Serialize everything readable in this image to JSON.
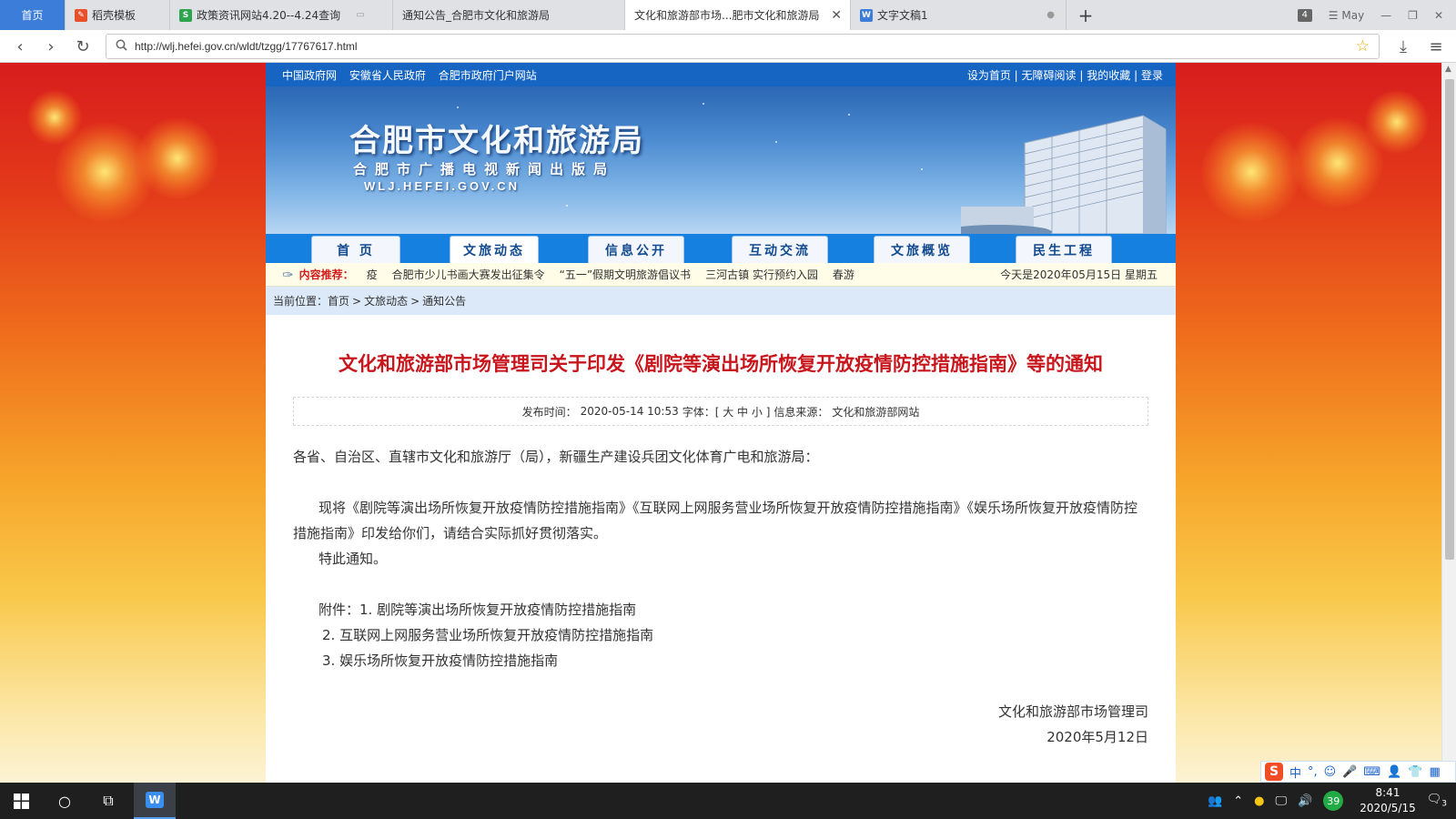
{
  "browser": {
    "tabs": [
      {
        "label": "首页",
        "icon": "home"
      },
      {
        "label": "稻壳模板",
        "icon": "docer-icon"
      },
      {
        "label": "政策资讯网站4.20--4.24查询",
        "icon": "sheet-icon"
      },
      {
        "label": "通知公告_合肥市文化和旅游局",
        "icon": ""
      },
      {
        "label": "文化和旅游部市场...肥市文化和旅游局",
        "icon": ""
      },
      {
        "label": "文字文稿1",
        "icon": "word-icon"
      }
    ],
    "tab_count": "4",
    "profile_label": "May",
    "url": "http://wlj.hefei.gov.cn/wldt/tzgg/17767617.html"
  },
  "site": {
    "top_links": [
      "中国政府网",
      "安徽省人民政府",
      "合肥市政府门户网站"
    ],
    "top_right": [
      "设为首页",
      "|",
      "无障碍阅读",
      "|",
      "我的收藏",
      "|",
      "登录"
    ],
    "title": "合肥市文化和旅游局",
    "subtitle": "合肥市广播电视新闻出版局",
    "domain": "WLJ.HEFEI.GOV.CN",
    "menu": [
      "首 页",
      "文旅动态",
      "信息公开",
      "互动交流",
      "文旅概览",
      "民生工程"
    ],
    "menu_active": "文旅动态",
    "ticker": {
      "label": "内容推荐：",
      "items": [
        "疫 ",
        "合肥市少儿书画大赛发出征集令",
        "“五一”假期文明旅游倡议书",
        "三河古镇 实行预约入园",
        "春游"
      ],
      "date": "今天是2020年05月15日 星期五"
    },
    "breadcrumb": {
      "prefix": "当前位置：",
      "items": [
        "首页",
        "文旅动态",
        "通知公告"
      ],
      "sep": ">"
    }
  },
  "article": {
    "title": "文化和旅游部市场管理司关于印发《剧院等演出场所恢复开放疫情防控措施指南》等的通知",
    "meta": {
      "publish_label": "发布时间：",
      "publish_time": "2020-05-14 10:53",
      "font_label": "字体：[ 大 中 小 ]",
      "source_label": "信息来源：",
      "source": "文化和旅游部网站"
    },
    "salutation": "各省、自治区、直辖市文化和旅游厅（局），新疆生产建设兵团文化体育广电和旅游局：",
    "body": "现将《剧院等演出场所恢复开放疫情防控措施指南》《互联网上网服务营业场所恢复开放疫情防控措施指南》《娱乐场所恢复开放疫情防控措施指南》印发给你们，请结合实际抓好贯彻落实。",
    "closing": "特此通知。",
    "attachments_label": "附件：1. 剧院等演出场所恢复开放疫情防控措施指南",
    "attachment_2": "2. 互联网上网服务营业场所恢复开放疫情防控措施指南",
    "attachment_3": "3. 娱乐场所恢复开放疫情防控措施指南",
    "signature": "文化和旅游部市场管理司",
    "date": "2020年5月12日"
  },
  "taskbar": {
    "time": "8:41",
    "date": "2020/5/15",
    "notif_count": "3",
    "badge": "39"
  },
  "ime": {
    "label": "中",
    "punct": "°,"
  }
}
